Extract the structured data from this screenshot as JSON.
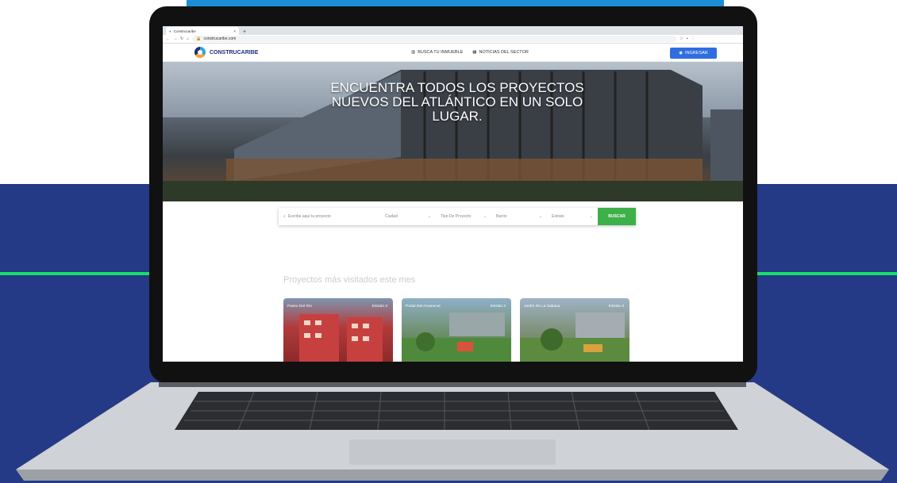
{
  "browser": {
    "tab_title": "Construcaribe",
    "url": "construcaribe.com"
  },
  "header": {
    "brand": "CONSTRUCARIBE",
    "nav": [
      {
        "label": "BUSCA TU INMUEBLE",
        "icon": "building-icon"
      },
      {
        "label": "NOTICIAS DEL SECTOR",
        "icon": "news-icon"
      }
    ],
    "login_label": "INGRESAR"
  },
  "hero": {
    "title_lines": [
      "ENCUENTRA TODOS LOS PROYECTOS",
      "NUEVOS DEL ATLÁNTICO EN UN SOLO",
      "LUGAR."
    ]
  },
  "search": {
    "placeholder": "Escribe aquí tu proyecto",
    "filters": [
      "Ciudad",
      "Tipo De Proyecto",
      "Barrio",
      "Estrato"
    ],
    "button_label": "BUSCAR"
  },
  "featured": {
    "title": "Proyectos más visitados este mes",
    "cards": [
      {
        "name": "Paseo Del Río",
        "stratum": "Estrato 3"
      },
      {
        "name": "Portal Del Amanecer",
        "stratum": "Estrato 3"
      },
      {
        "name": "Jardín De La Sabana",
        "stratum": "Estrato 3"
      }
    ]
  },
  "colors": {
    "brand_navy": "#1c2e74",
    "accent_blue": "#2f6de0",
    "search_green": "#3eb049",
    "background_navy": "#253a86",
    "background_line": "#18e06a"
  }
}
